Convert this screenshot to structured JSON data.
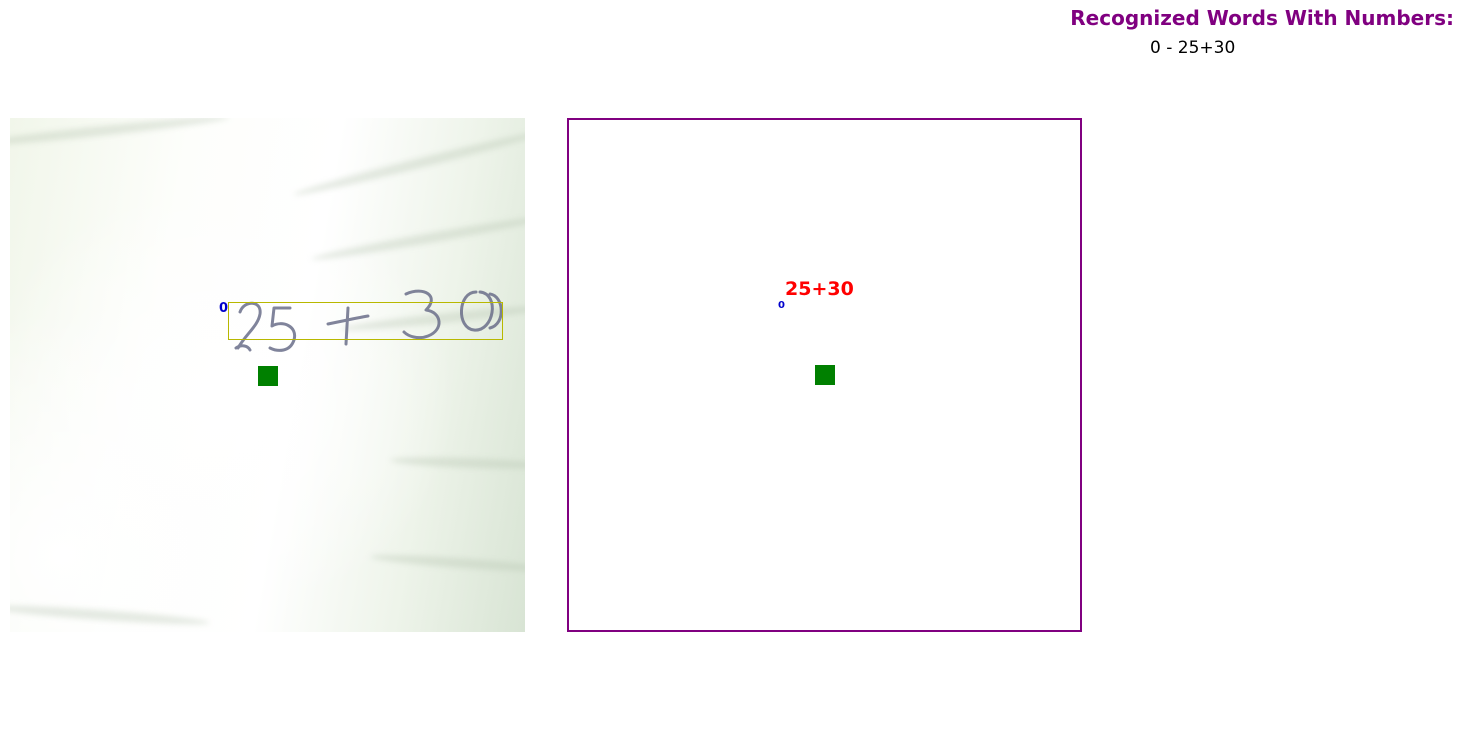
{
  "header": {
    "title": "Recognized Words With Numbers:"
  },
  "results": [
    {
      "index": "0",
      "separator": " - ",
      "text": "25+30"
    }
  ],
  "photo": {
    "box_index": "0",
    "handwritten_text": "25 + 30"
  },
  "canvas": {
    "word": "25+30",
    "word_index": "0"
  },
  "colors": {
    "title": "#800080",
    "canvas_border": "#800080",
    "word": "#ff0000",
    "index": "#0000cc",
    "detection_box": "#b8b800",
    "marker": "#008000"
  }
}
